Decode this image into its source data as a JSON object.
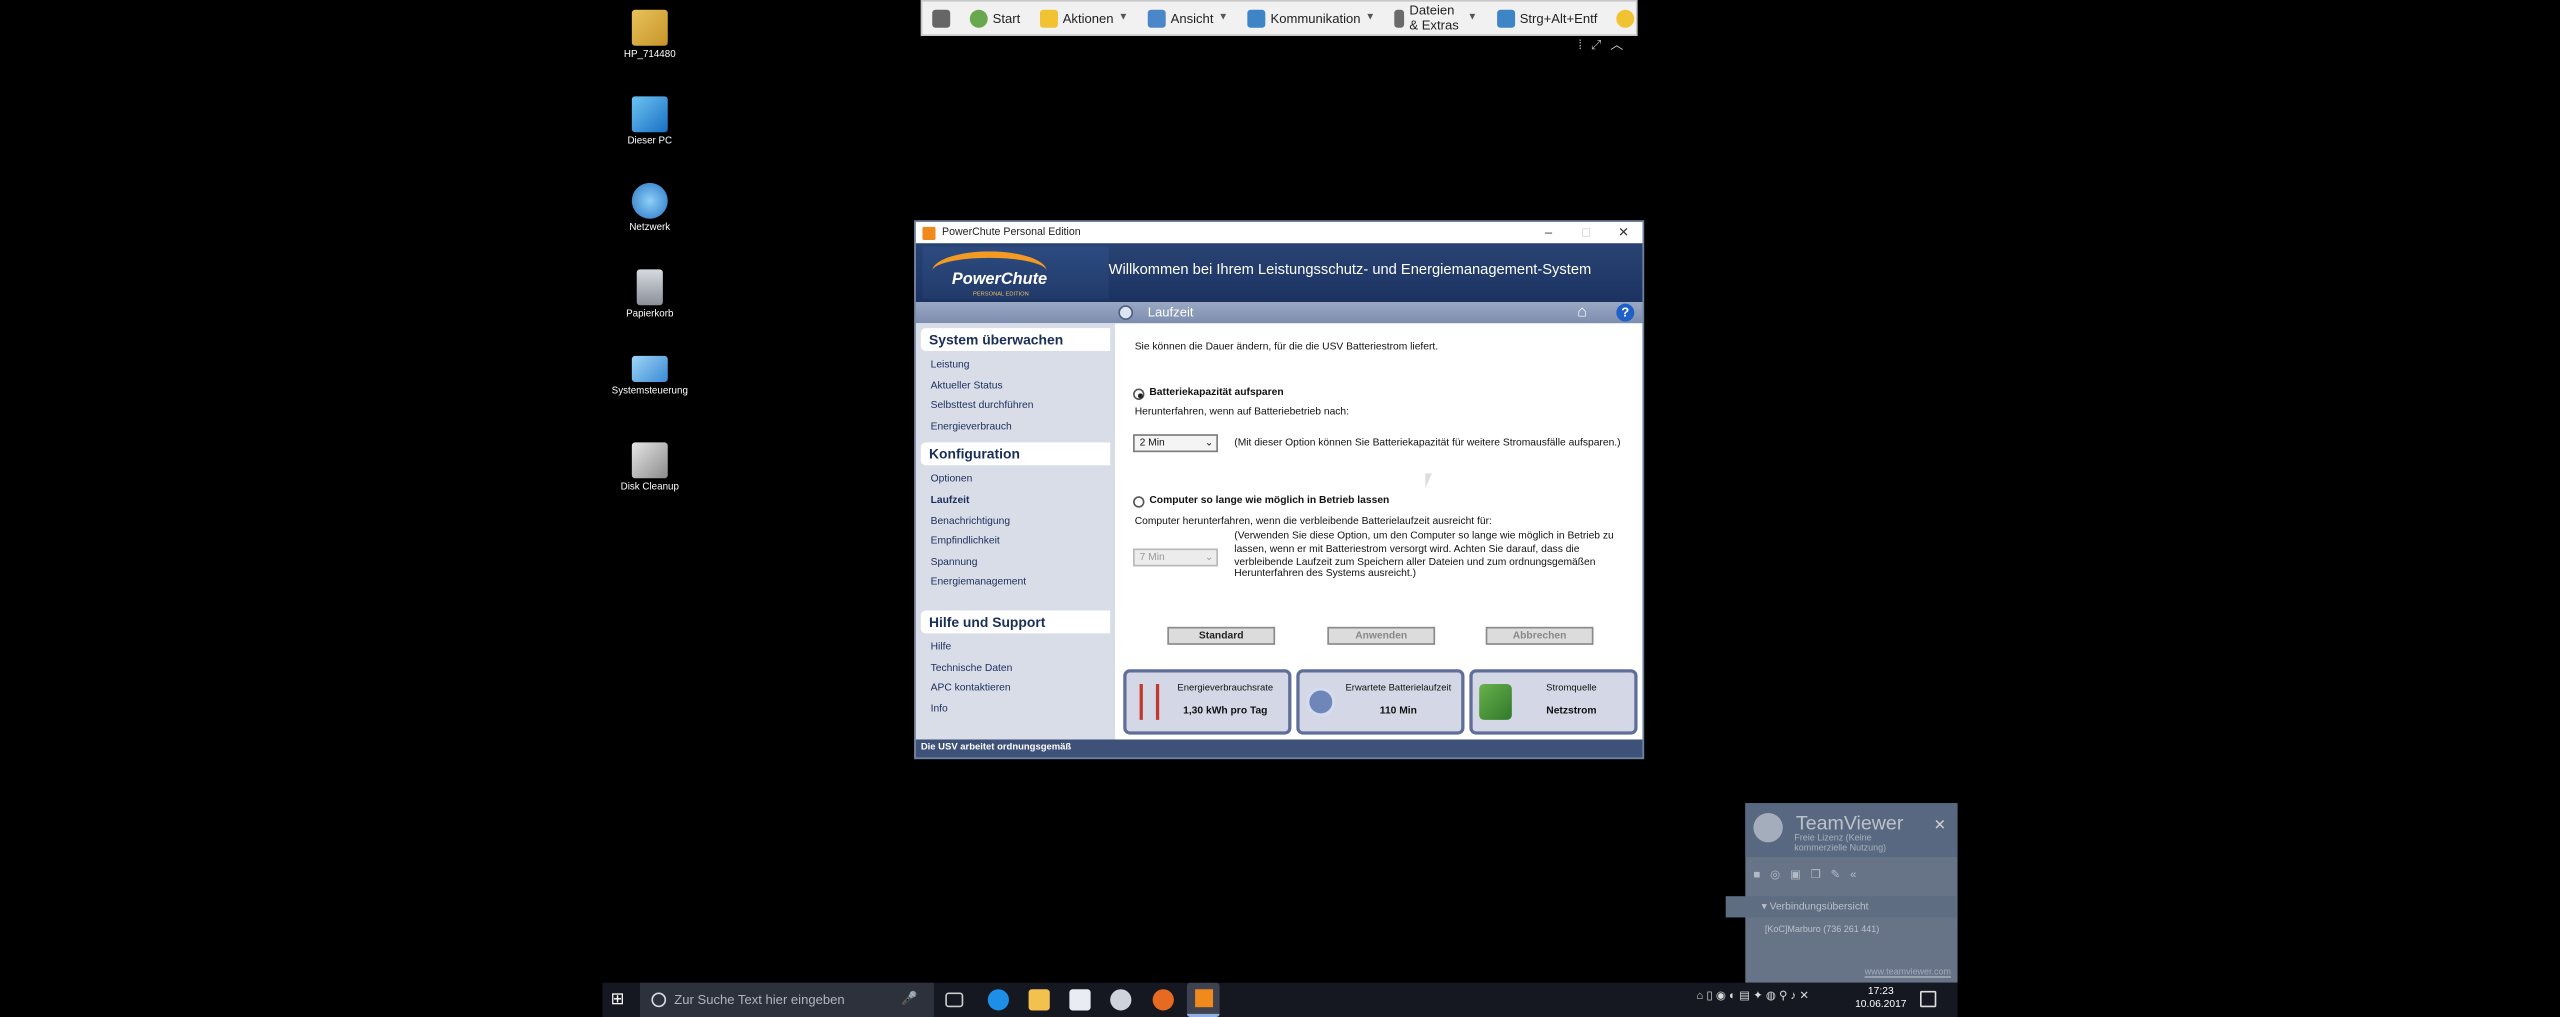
{
  "desktop_icons": [
    {
      "label": "HP_714480",
      "icon": "user-folder-icon"
    },
    {
      "label": "Dieser PC",
      "icon": "computer-icon"
    },
    {
      "label": "Netzwerk",
      "icon": "network-globe-icon"
    },
    {
      "label": "Papierkorb",
      "icon": "recycle-bin-icon"
    },
    {
      "label": "Systemsteuerung",
      "icon": "control-panel-icon"
    },
    {
      "label": "Disk Cleanup",
      "icon": "disk-cleanup-icon"
    }
  ],
  "remote_toolbar": {
    "items": [
      "Start",
      "Aktionen",
      "Ansicht",
      "Kommunikation",
      "Dateien & Extras",
      "Strg+Alt+Entf"
    ]
  },
  "window": {
    "title": "PowerChute Personal Edition",
    "brand_name": "PowerChute",
    "brand_edition": "PERSONAL EDITION",
    "welcome": "Willkommen bei Ihrem Leistungsschutz- und Energiemanagement-System",
    "section_title": "Laufzeit",
    "sidebar": {
      "sections": [
        {
          "title": "System überwachen",
          "links": [
            "Leistung",
            "Aktueller Status",
            "Selbsttest durchführen",
            "Energieverbrauch"
          ]
        },
        {
          "title": "Konfiguration",
          "links": [
            "Optionen",
            "Laufzeit",
            "Benachrichtigung",
            "Empfindlichkeit",
            "Spannung",
            "Energiemanagement"
          ]
        },
        {
          "title": "Hilfe und Support",
          "links": [
            "Hilfe",
            "Technische Daten",
            "APC kontaktieren",
            "Info"
          ]
        }
      ]
    },
    "content": {
      "intro": "Sie können die Dauer ändern, für die die USV Batteriestrom liefert.",
      "option1_label": "Batteriekapazität aufsparen",
      "option1_sub": "Herunterfahren, wenn auf Batteriebetrieb nach:",
      "option1_value": "2 Min",
      "option1_note": "(Mit dieser Option können Sie Batteriekapazität für weitere Stromausfälle aufsparen.)",
      "option2_label": "Computer so lange wie möglich in Betrieb lassen",
      "option2_sub": "Computer herunterfahren, wenn die verbleibende Batterielaufzeit ausreicht für:",
      "option2_value": "7 Min",
      "option2_note": "(Verwenden Sie diese Option, um den Computer so lange wie möglich in Betrieb zu lassen, wenn er mit Batteriestrom versorgt wird. Achten Sie darauf, dass die verbleibende Laufzeit zum Speichern aller Dateien und zum ordnungsgemäßen Herunterfahren des Systems ausreicht.)",
      "buttons": {
        "standard": "Standard",
        "apply": "Anwenden",
        "cancel": "Abbrechen"
      }
    },
    "cards": [
      {
        "label": "Energieverbrauchsrate",
        "value": "1,30 kWh pro Tag",
        "icon": "power-tower-icon"
      },
      {
        "label": "Erwartete Batterielaufzeit",
        "value": "110 Min",
        "icon": "clock-icon"
      },
      {
        "label": "Stromquelle",
        "value": "Netzstrom",
        "icon": "power-plug-icon"
      }
    ],
    "status": "Die USV arbeitet ordnungsgemäß"
  },
  "teamviewer": {
    "name": "TeamViewer",
    "subtitle_line1": "Freie Lizenz (Keine",
    "subtitle_line2": "kommerzielle Nutzung)",
    "connection_header": "Verbindungsübersicht",
    "partner": "[KoC]Marburo (736 261 441)",
    "url": "www.teamviewer.com"
  },
  "taskbar": {
    "search_placeholder": "Zur Suche Text hier eingeben",
    "time": "17:23",
    "date": "10.06.2017"
  },
  "colors": {
    "accent": "#1c3362",
    "brand_orange": "#f39a22",
    "status_bar": "#3e5178"
  }
}
